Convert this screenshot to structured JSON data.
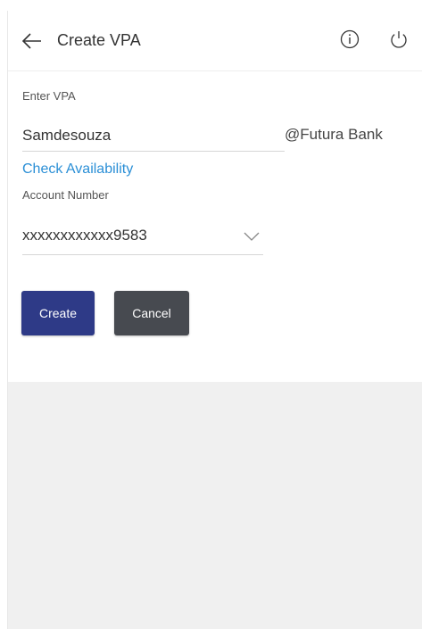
{
  "header": {
    "title": "Create VPA",
    "back_icon": "arrow-left-icon",
    "info_icon": "info-icon",
    "power_icon": "power-icon"
  },
  "form": {
    "vpa_label": "Enter VPA",
    "vpa_value": "Samdesouza",
    "vpa_suffix": "@Futura Bank",
    "check_availability": "Check Availability",
    "account_label": "Account Number",
    "account_value": "xxxxxxxxxxxx9583"
  },
  "actions": {
    "create_label": "Create",
    "cancel_label": "Cancel"
  },
  "colors": {
    "primary": "#2e3a87",
    "secondary": "#474a50",
    "link": "#2b8fd6",
    "background": "#f0f0f0"
  }
}
